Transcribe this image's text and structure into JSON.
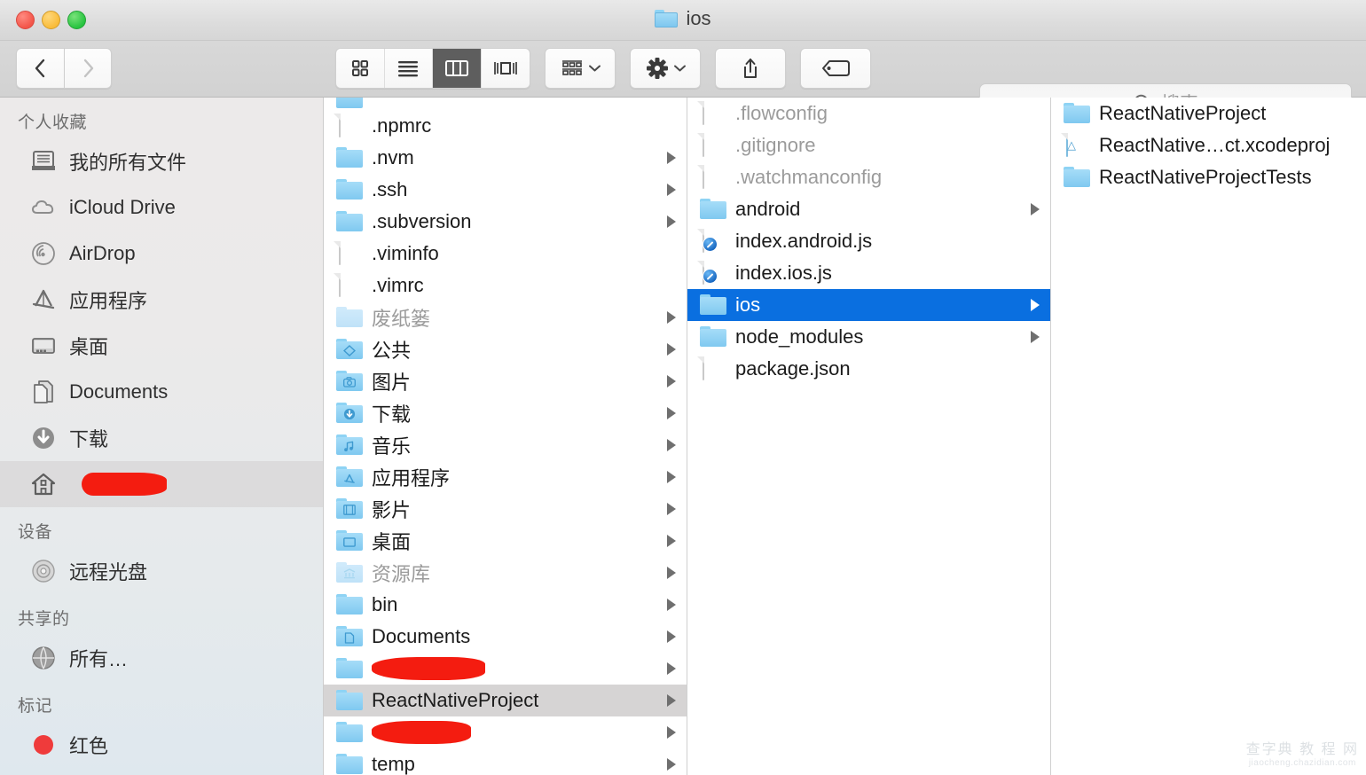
{
  "window": {
    "title": "ios",
    "title_icon": "folder-icon",
    "traffic_lights": [
      {
        "name": "close-button",
        "color": "#f35549"
      },
      {
        "name": "minimize-button",
        "color": "#f9bc3a"
      },
      {
        "name": "zoom-button",
        "color": "#28c440"
      }
    ]
  },
  "toolbar": {
    "back_label": "‹",
    "forward_label": "›",
    "view_modes": [
      {
        "name": "icon-view",
        "label": "Icon View",
        "active": false
      },
      {
        "name": "list-view",
        "label": "List View",
        "active": false
      },
      {
        "name": "column-view",
        "label": "Column View",
        "active": true
      },
      {
        "name": "gallery-view",
        "label": "Gallery View",
        "active": false
      }
    ],
    "arrange_label": "Arrange",
    "action_label": "Action",
    "share_label": "Share",
    "tags_label": "Tags"
  },
  "search": {
    "placeholder": "搜索",
    "value": ""
  },
  "sidebar": {
    "sections": [
      {
        "header": "个人收藏",
        "items": [
          {
            "label": "我的所有文件",
            "icon": "all-my-files-icon",
            "selected": false,
            "redacted": false
          },
          {
            "label": "iCloud Drive",
            "icon": "icloud-icon",
            "selected": false,
            "redacted": false
          },
          {
            "label": "AirDrop",
            "icon": "airdrop-icon",
            "selected": false,
            "redacted": false
          },
          {
            "label": "应用程序",
            "icon": "applications-icon",
            "selected": false,
            "redacted": false
          },
          {
            "label": "桌面",
            "icon": "desktop-icon",
            "selected": false,
            "redacted": false
          },
          {
            "label": "Documents",
            "icon": "documents-icon",
            "selected": false,
            "redacted": false
          },
          {
            "label": "下载",
            "icon": "downloads-icon",
            "selected": false,
            "redacted": false
          },
          {
            "label": "",
            "icon": "home-icon",
            "selected": true,
            "redacted": true
          }
        ]
      },
      {
        "header": "设备",
        "items": [
          {
            "label": "远程光盘",
            "icon": "remote-disc-icon",
            "selected": false,
            "redacted": false
          }
        ]
      },
      {
        "header": "共享的",
        "items": [
          {
            "label": "所有…",
            "icon": "network-globe-icon",
            "selected": false,
            "redacted": false
          }
        ]
      },
      {
        "header": "标记",
        "items": [
          {
            "label": "红色",
            "icon": "red-tag-icon",
            "selected": false,
            "redacted": false
          }
        ]
      }
    ]
  },
  "columns": [
    {
      "name": "column-home",
      "rows": [
        {
          "label": "",
          "kind": "folder",
          "partial": true,
          "arrow": false,
          "dim": false,
          "selected": "none",
          "redacted": false
        },
        {
          "label": ".npmrc",
          "kind": "document",
          "arrow": false,
          "dim": false,
          "selected": "none",
          "redacted": false
        },
        {
          "label": ".nvm",
          "kind": "folder",
          "arrow": true,
          "dim": false,
          "selected": "none",
          "redacted": false
        },
        {
          "label": ".ssh",
          "kind": "folder",
          "arrow": true,
          "dim": false,
          "selected": "none",
          "redacted": false
        },
        {
          "label": ".subversion",
          "kind": "folder",
          "arrow": true,
          "dim": false,
          "selected": "none",
          "redacted": false
        },
        {
          "label": ".viminfo",
          "kind": "document",
          "arrow": false,
          "dim": false,
          "selected": "none",
          "redacted": false
        },
        {
          "label": ".vimrc",
          "kind": "document",
          "arrow": false,
          "dim": false,
          "selected": "none",
          "redacted": false
        },
        {
          "label": "废纸篓",
          "kind": "folder-faded",
          "arrow": true,
          "dim": true,
          "selected": "none",
          "redacted": false
        },
        {
          "label": "公共",
          "kind": "folder-public",
          "arrow": true,
          "dim": false,
          "selected": "none",
          "redacted": false
        },
        {
          "label": "图片",
          "kind": "folder-pictures",
          "arrow": true,
          "dim": false,
          "selected": "none",
          "redacted": false
        },
        {
          "label": "下载",
          "kind": "folder-downloads",
          "arrow": true,
          "dim": false,
          "selected": "none",
          "redacted": false
        },
        {
          "label": "音乐",
          "kind": "folder-music",
          "arrow": true,
          "dim": false,
          "selected": "none",
          "redacted": false
        },
        {
          "label": "应用程序",
          "kind": "folder-apps",
          "arrow": true,
          "dim": false,
          "selected": "none",
          "redacted": false
        },
        {
          "label": "影片",
          "kind": "folder-movies",
          "arrow": true,
          "dim": false,
          "selected": "none",
          "redacted": false
        },
        {
          "label": "桌面",
          "kind": "folder-desktop",
          "arrow": true,
          "dim": false,
          "selected": "none",
          "redacted": false
        },
        {
          "label": "资源库",
          "kind": "folder-library-faded",
          "arrow": true,
          "dim": true,
          "selected": "none",
          "redacted": false
        },
        {
          "label": "bin",
          "kind": "folder",
          "arrow": true,
          "dim": false,
          "selected": "none",
          "redacted": false
        },
        {
          "label": "Documents",
          "kind": "folder-documents",
          "arrow": true,
          "dim": false,
          "selected": "none",
          "redacted": false
        },
        {
          "label": "",
          "kind": "folder",
          "arrow": true,
          "dim": false,
          "selected": "none",
          "redacted": true
        },
        {
          "label": "ReactNativeProject",
          "kind": "folder",
          "arrow": true,
          "dim": false,
          "selected": "gray",
          "redacted": false
        },
        {
          "label": "",
          "kind": "folder",
          "arrow": true,
          "dim": false,
          "selected": "none",
          "redacted": true
        },
        {
          "label": "temp",
          "kind": "folder",
          "arrow": true,
          "dim": false,
          "selected": "none",
          "redacted": false
        }
      ]
    },
    {
      "name": "column-reactnativeproject",
      "rows": [
        {
          "label": ".flowconfig",
          "kind": "document",
          "arrow": false,
          "dim": true,
          "selected": "none",
          "redacted": false
        },
        {
          "label": ".gitignore",
          "kind": "document",
          "arrow": false,
          "dim": true,
          "selected": "none",
          "redacted": false
        },
        {
          "label": ".watchmanconfig",
          "kind": "document",
          "arrow": false,
          "dim": true,
          "selected": "none",
          "redacted": false
        },
        {
          "label": "android",
          "kind": "folder",
          "arrow": true,
          "dim": false,
          "selected": "none",
          "redacted": false
        },
        {
          "label": "index.android.js",
          "kind": "document-js",
          "arrow": false,
          "dim": false,
          "selected": "none",
          "redacted": false
        },
        {
          "label": "index.ios.js",
          "kind": "document-js",
          "arrow": false,
          "dim": false,
          "selected": "none",
          "redacted": false
        },
        {
          "label": "ios",
          "kind": "folder",
          "arrow": true,
          "dim": false,
          "selected": "blue",
          "redacted": false
        },
        {
          "label": "node_modules",
          "kind": "folder",
          "arrow": true,
          "dim": false,
          "selected": "none",
          "redacted": false
        },
        {
          "label": "package.json",
          "kind": "document-text",
          "arrow": false,
          "dim": false,
          "selected": "none",
          "redacted": false
        }
      ]
    },
    {
      "name": "column-ios",
      "rows": [
        {
          "label": "ReactNativeProject",
          "kind": "folder",
          "arrow": false,
          "dim": false,
          "selected": "none",
          "redacted": false
        },
        {
          "label": "ReactNative…ct.xcodeproj",
          "kind": "document-xcode",
          "arrow": false,
          "dim": false,
          "selected": "none",
          "redacted": false
        },
        {
          "label": "ReactNativeProjectTests",
          "kind": "folder",
          "arrow": false,
          "dim": false,
          "selected": "none",
          "redacted": false
        }
      ]
    }
  ],
  "watermark": {
    "line1": "查字典 教 程 网",
    "line2": "jiaocheng.chazidian.com"
  },
  "colors": {
    "selection_blue": "#0a6fe0",
    "selection_gray": "#d6d4d4",
    "folder_blue": "#8ed3f4",
    "active_toolbar": "#5e5e5e"
  }
}
